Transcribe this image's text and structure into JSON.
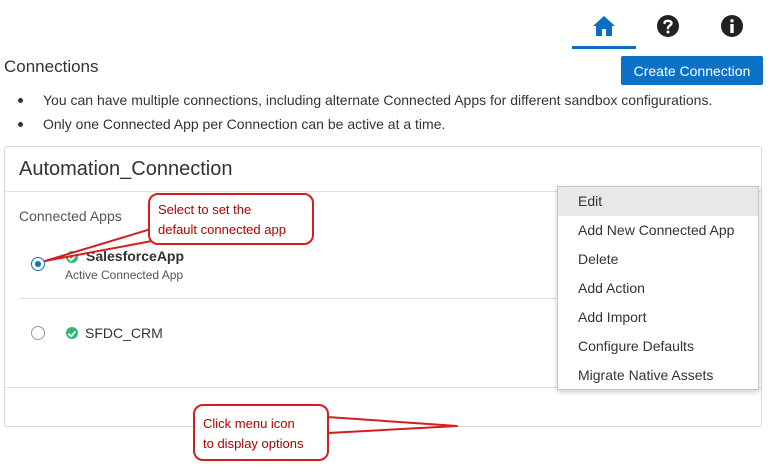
{
  "page": {
    "title": "Connections",
    "create_button": "Create Connection",
    "bullets": [
      "You can have multiple connections, including alternate Connected Apps for different sandbox configurations.",
      "Only one Connected App per Connection can be active at a time."
    ]
  },
  "nav": {
    "items": [
      {
        "icon": "home-icon",
        "active": true
      },
      {
        "icon": "help-icon",
        "active": false
      },
      {
        "icon": "info-icon",
        "active": false
      }
    ],
    "accent": "#0a6fc2"
  },
  "connection": {
    "name": "Automation_Connection",
    "section_label": "Connected Apps",
    "apps": [
      {
        "name": "SalesforceApp",
        "status": "Active Connected App",
        "selected": true
      },
      {
        "name": "SFDC_CRM",
        "status": "",
        "selected": false
      }
    ]
  },
  "menu": {
    "items": [
      "Edit",
      "Add New Connected App",
      "Delete",
      "Add Action",
      "Add Import",
      "Configure Defaults",
      "Migrate Native Assets"
    ],
    "highlighted": "Edit"
  },
  "callouts": {
    "radio_hint": [
      "Select to set the",
      "default connected app"
    ],
    "menu_hint": [
      "Click menu icon",
      "to display options"
    ]
  },
  "colors": {
    "primary": "#0b72c8",
    "success": "#2eb872",
    "callout": "#d21f1f"
  }
}
